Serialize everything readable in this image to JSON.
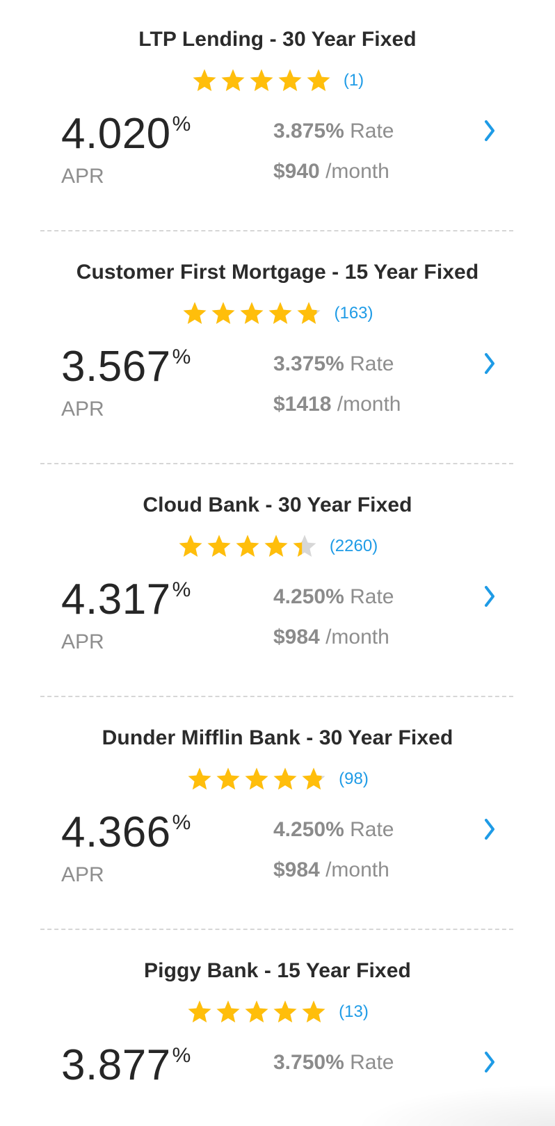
{
  "colors": {
    "star_filled": "#FFBE0B",
    "star_empty": "#D7D7D7",
    "accent": "#1E9BE6",
    "text_dark": "#262626",
    "text_muted": "#8E8E8E"
  },
  "icons": {
    "star": "star-icon",
    "chevron": "chevron-right-icon"
  },
  "lenders": [
    {
      "title": "LTP Lending - 30 Year Fixed",
      "rating": 5.0,
      "review_count": "(1)",
      "apr": "4.020",
      "apr_suffix": "%",
      "apr_label": "APR",
      "rate": "3.875%",
      "rate_label": "Rate",
      "monthly": "$940",
      "monthly_label": "/month"
    },
    {
      "title": "Customer First Mortgage - 15 Year Fixed",
      "rating": 4.8,
      "review_count": "(163)",
      "apr": "3.567",
      "apr_suffix": "%",
      "apr_label": "APR",
      "rate": "3.375%",
      "rate_label": "Rate",
      "monthly": "$1418",
      "monthly_label": "/month"
    },
    {
      "title": "Cloud Bank - 30 Year Fixed",
      "rating": 4.4,
      "review_count": "(2260)",
      "apr": "4.317",
      "apr_suffix": "%",
      "apr_label": "APR",
      "rate": "4.250%",
      "rate_label": "Rate",
      "monthly": "$984",
      "monthly_label": "/month"
    },
    {
      "title": "Dunder Mifflin Bank - 30 Year Fixed",
      "rating": 4.8,
      "review_count": "(98)",
      "apr": "4.366",
      "apr_suffix": "%",
      "apr_label": "APR",
      "rate": "4.250%",
      "rate_label": "Rate",
      "monthly": "$984",
      "monthly_label": "/month"
    },
    {
      "title": "Piggy Bank - 15 Year Fixed",
      "rating": 5.0,
      "review_count": "(13)",
      "apr": "3.877",
      "apr_suffix": "%",
      "apr_label": "APR",
      "rate": "3.750%",
      "rate_label": "Rate",
      "monthly": "",
      "monthly_label": ""
    }
  ]
}
